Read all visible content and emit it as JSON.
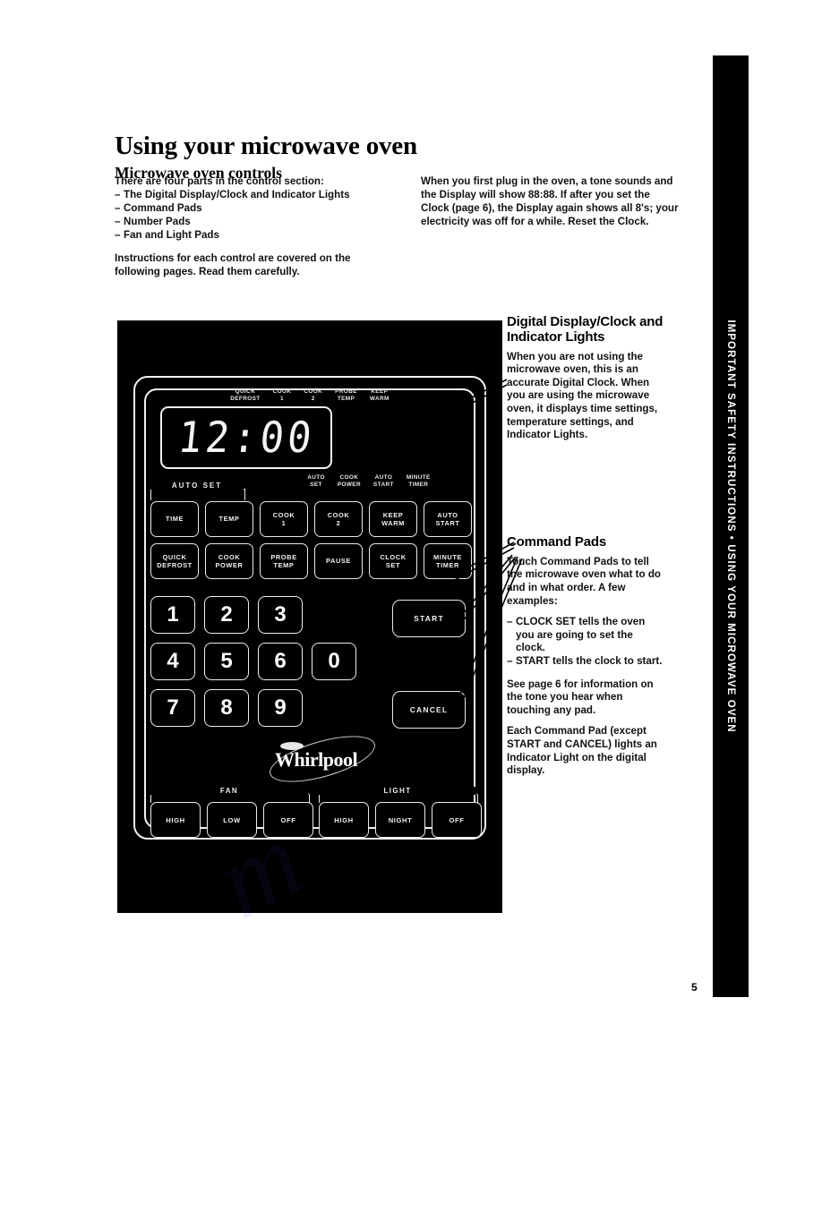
{
  "sidebar": {
    "label": "IMPORTANT SAFETY INSTRUCTIONS • USING YOUR MICROWAVE OVEN"
  },
  "page": {
    "number": "5"
  },
  "headings": {
    "title": "Using your microwave oven",
    "subtitle": "Microwave oven controls"
  },
  "left_column": {
    "intro": "There are four parts in the control section:",
    "parts": [
      "The Digital Display/Clock and Indicator Lights",
      "Command Pads",
      "Number Pads",
      "Fan and Light Pads"
    ],
    "dash": "–",
    "closing": "Instructions for each control are covered on the following pages. Read them carefully."
  },
  "right_column_top": {
    "text": "When you first plug in the oven, a tone sounds and the Display will show 88:88. If after you set the Clock (page 6), the Display again shows all 8's; your electricity was off for a while. Reset the Clock."
  },
  "annotations": {
    "display": {
      "heading": "Digital Display/Clock and Indicator Lights",
      "body": "When you are not using the microwave oven, this is an accurate Digital Clock. When you are using the microwave oven, it displays time settings, temperature settings, and Indicator Lights."
    },
    "command": {
      "heading": "Command Pads",
      "body1": "Touch Command Pads to tell the microwave oven what to do and in what order. A few examples:",
      "examples": [
        "CLOCK SET tells the oven you are going to set the clock.",
        "START tells the clock to start."
      ],
      "dash": "–",
      "body2": "See page 6 for information on the tone you hear when touching any pad.",
      "body3": "Each Command Pad (except START and CANCEL) lights an Indicator Light on the digital display."
    }
  },
  "control_panel": {
    "indicators_top": [
      "QUICK\nDEFROST",
      "COOK\n1",
      "COOK\n2",
      "PROBE\nTEMP",
      "KEEP\nWARM"
    ],
    "indicators_bottom": [
      "AUTO\nSET",
      "COOK\nPOWER",
      "AUTO\nSTART",
      "MINUTE\nTIMER"
    ],
    "display_value": "12:00",
    "autoset_label": "AUTO SET",
    "command_row1": [
      "TIME",
      "TEMP",
      "COOK\n1",
      "COOK\n2",
      "KEEP\nWARM",
      "AUTO\nSTART"
    ],
    "command_row2": [
      "QUICK\nDEFROST",
      "COOK\nPOWER",
      "PROBE\nTEMP",
      "PAUSE",
      "CLOCK\nSET",
      "MINUTE\nTIMER"
    ],
    "numbers": [
      [
        "1",
        "2",
        "3"
      ],
      [
        "4",
        "5",
        "6",
        "0"
      ],
      [
        "7",
        "8",
        "9"
      ]
    ],
    "start_label": "START",
    "cancel_label": "CANCEL",
    "brand": "Whirlpool",
    "fan": {
      "label": "FAN",
      "keys": [
        "HIGH",
        "LOW",
        "OFF"
      ]
    },
    "light": {
      "label": "LIGHT",
      "keys": [
        "HIGH",
        "NIGHT",
        "OFF"
      ]
    }
  },
  "colors": {
    "panel": "#000000",
    "panel_line": "#f2f2f2",
    "paper": "#ffffff"
  }
}
